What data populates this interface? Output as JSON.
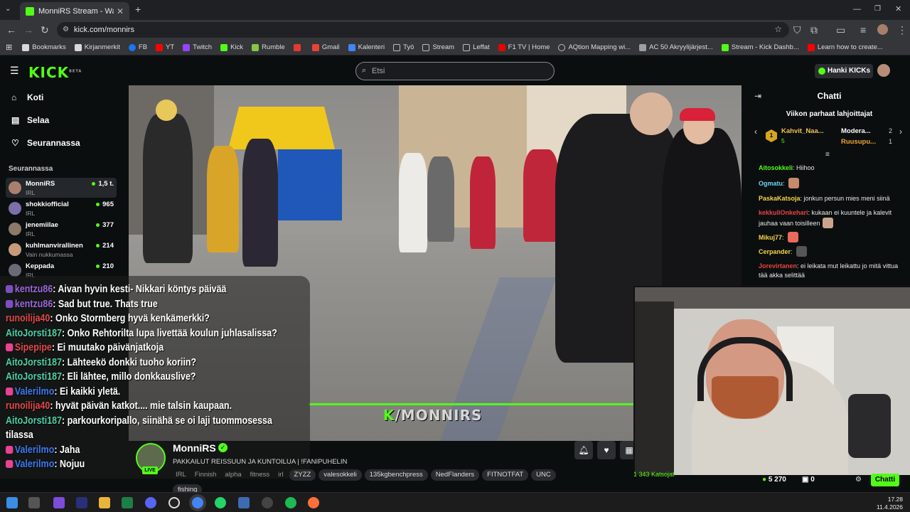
{
  "browser": {
    "tab_title": "MonniRS Stream - Watch Li",
    "url": "kick.com/monnirs"
  },
  "bookmarks": [
    {
      "label": "Bookmarks",
      "color": "#d9d9d9"
    },
    {
      "label": "Kirjanmerkit",
      "color": "#d9d9d9"
    },
    {
      "label": "FB",
      "color": "#1877f2"
    },
    {
      "label": "YT",
      "color": "#ff0000"
    },
    {
      "label": "Twitch",
      "color": "#9146ff"
    },
    {
      "label": "Kick",
      "color": "#53fc18"
    },
    {
      "label": "Rumble",
      "color": "#85c742"
    },
    {
      "label": "",
      "color": "#e23b2e"
    },
    {
      "label": "Gmail",
      "color": "#ea4335"
    },
    {
      "label": "Kalenteri",
      "color": "#4285f4"
    },
    {
      "label": "Työ",
      "color": "#bbbbbb"
    },
    {
      "label": "Stream",
      "color": "#bbbbbb"
    },
    {
      "label": "Leffat",
      "color": "#bbbbbb"
    },
    {
      "label": "F1 TV | Home",
      "color": "#e10600"
    },
    {
      "label": "AQtion Mapping wi...",
      "color": "#bbbbbb"
    },
    {
      "label": "AC 50 Akryylijärjest...",
      "color": "#bbbbbb"
    },
    {
      "label": "Stream - Kick Dashb...",
      "color": "#53fc18"
    },
    {
      "label": "Learn how to create...",
      "color": "#ff0000"
    }
  ],
  "header": {
    "search_placeholder": "Etsi",
    "get_kicks": "Hanki KICKs",
    "logo": "KICK",
    "logo_beta": "BETA"
  },
  "sidebar": {
    "nav": [
      "Koti",
      "Selaa",
      "Seurannassa"
    ],
    "following_title": "Seurannassa",
    "following": [
      {
        "name": "MonniRS",
        "category": "IRL",
        "viewers": "1,5 t.",
        "color": "#a9806e"
      },
      {
        "name": "shokkiofficial",
        "category": "IRL",
        "viewers": "965",
        "color": "#7d6fa8"
      },
      {
        "name": "jenemiilae",
        "category": "IRL",
        "viewers": "377",
        "color": "#8c7a6a"
      },
      {
        "name": "kuhlmanvirallinen",
        "category": "Vain nukkumassa",
        "viewers": "214",
        "color": "#c79a7a"
      },
      {
        "name": "Keppada",
        "category": "IRL",
        "viewers": "210",
        "color": "#6a6a78"
      }
    ]
  },
  "overlay_chat": [
    {
      "user": "kentzu86",
      "msg": ": Aivan hyvin kesti- Nikkari köntys päivää",
      "cls": "u1",
      "badge": "#7b4fc0"
    },
    {
      "user": "kentzu86",
      "msg": ": Sad but true. Thats true",
      "cls": "u1",
      "badge": "#7b4fc0"
    },
    {
      "user": "runoilija40",
      "msg": ": Onko Stormberg hyvä kenkämerkki?",
      "cls": "u3",
      "badge": ""
    },
    {
      "user": "AitoJorsti187",
      "msg": ": Onko Rehtorilta lupa livettää koulun juhlasalissa?",
      "cls": "u2",
      "badge": ""
    },
    {
      "user": "Sipepipe",
      "msg": ": Ei muutako päivänjatkoja",
      "cls": "u3",
      "badge": "#e84393"
    },
    {
      "user": "AitoJorsti187",
      "msg": ": Lähteekö donkki tuoho koriin?",
      "cls": "u2",
      "badge": ""
    },
    {
      "user": "AitoJorsti187",
      "msg": ": Eli lähtee, millo donkkauslive?",
      "cls": "u2",
      "badge": ""
    },
    {
      "user": "Valerilmo",
      "msg": ": Ei kaikki yletä.",
      "cls": "u4",
      "badge": "#e84393"
    },
    {
      "user": "runoilija40",
      "msg": ": hyvät päivän katkot.... mie talsin kaupaan.",
      "cls": "u3",
      "badge": ""
    },
    {
      "user": "AitoJorsti187",
      "msg": ": parkourkoripallo, siinähä se oi laji tuommosessa",
      "cls": "u2",
      "badge": ""
    },
    {
      "user": "",
      "msg": "tilassa",
      "cls": "u2",
      "badge": ""
    },
    {
      "user": "Valerilmo",
      "msg": ": Jaha",
      "cls": "u4",
      "badge": "#e84393"
    },
    {
      "user": "Valerilmo",
      "msg": ": Nojuu",
      "cls": "u4",
      "badge": "#e84393"
    }
  ],
  "stream": {
    "name": "MonniRS",
    "title": "PAKKAILUT REISSUUN JA KUNTOILUA | !FANIPUHELIN",
    "live": "LIVE",
    "watermark_k": "K",
    "watermark_rest": "/MONNIRS",
    "tags_plain": [
      "IRL",
      "Finnish",
      "alpha",
      "fitness",
      "irl"
    ],
    "tags": [
      "ZYZZ",
      "valesokkeli",
      "135kgbenchpress",
      "NedFlanders",
      "FITNOTFAT",
      "UNC",
      "fishing"
    ]
  },
  "chat": {
    "title": "Chatti",
    "gifters_title": "Viikon parhaat lahjoittajat",
    "gifters": [
      {
        "rank": "1",
        "name": "Kahvit_Naa...",
        "count": "5"
      },
      {
        "rank": "",
        "name": "Modera...",
        "count": "2"
      },
      {
        "rank": "",
        "name": "Ruusupu...",
        "count": "1"
      }
    ],
    "messages": [
      {
        "user": "Aitosokkeli",
        "msg": ": Hiihoo",
        "color": "#53fc18",
        "emote": ""
      },
      {
        "user": "Ogmatu",
        "msg": ": ",
        "color": "#6fd3f7",
        "emote": "#c48a6a"
      },
      {
        "user": "PaskaKatsoja",
        "msg": ": jonkun persun mies meni siinä",
        "color": "#f5d547",
        "emote": ""
      },
      {
        "user": "kekkuliOnkehari",
        "msg": ": kukaan ei kuuntele ja kalevit jauhaa vaan toisilleen",
        "color": "#e84343",
        "emote": "#caa58d"
      },
      {
        "user": "Mikuj77",
        "msg": ": ",
        "color": "#f5d547",
        "emote": "#e86a5a"
      },
      {
        "user": "Cerpander",
        "msg": ": ",
        "color": "#f5d547",
        "emote": "#555555"
      },
      {
        "user": "Jorevirtanen",
        "msg": ": ei leikata mut leikattu jo mitä vittua tää akka selittää",
        "color": "#e84343",
        "emote": ""
      }
    ],
    "viewers": "5 270",
    "gifts": "0",
    "send": "Chatti",
    "watching": "1 343 Katsojat"
  },
  "taskbar": {
    "time": "17.28",
    "date": "11.4.2026"
  }
}
